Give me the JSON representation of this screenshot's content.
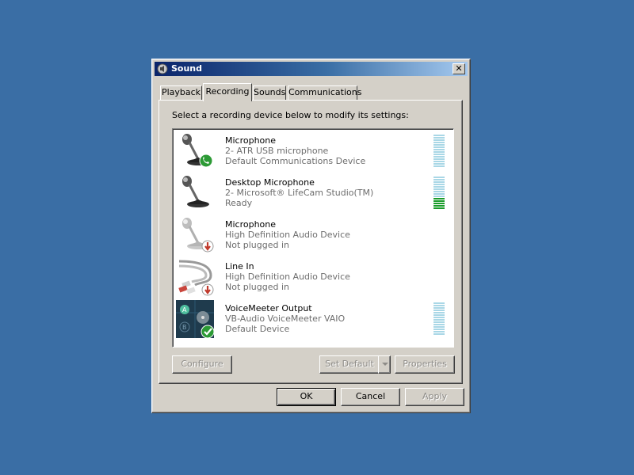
{
  "window": {
    "title": "Sound",
    "close_label": "✕"
  },
  "tabs": [
    {
      "label": "Playback",
      "active": false
    },
    {
      "label": "Recording",
      "active": true
    },
    {
      "label": "Sounds",
      "active": false
    },
    {
      "label": "Communications",
      "active": false
    }
  ],
  "instruction": "Select a recording device below to modify its settings:",
  "devices": [
    {
      "name": "Microphone",
      "description": "2- ATR USB microphone",
      "status": "Default Communications Device",
      "icon": "microphone-icon",
      "badge": "phone-badge-icon",
      "meter_level": 0
    },
    {
      "name": "Desktop Microphone",
      "description": "2- Microsoft® LifeCam Studio(TM)",
      "status": "Ready",
      "icon": "microphone-icon",
      "badge": "",
      "meter_level": 0.35
    },
    {
      "name": "Microphone",
      "description": "High Definition Audio Device",
      "status": "Not plugged in",
      "icon": "microphone-icon",
      "badge": "unplugged-badge-icon"
    },
    {
      "name": "Line In",
      "description": "High Definition Audio Device",
      "status": "Not plugged in",
      "icon": "line-in-cable-icon",
      "badge": "unplugged-badge-icon"
    },
    {
      "name": "VoiceMeeter Output",
      "description": "VB-Audio VoiceMeeter VAIO",
      "status": "Default Device",
      "icon": "voicemeeter-icon",
      "badge": "check-badge-icon",
      "meter_level": 0
    }
  ],
  "buttons": {
    "configure": "Configure",
    "set_default": "Set Default",
    "properties": "Properties",
    "ok": "OK",
    "cancel": "Cancel",
    "apply": "Apply"
  },
  "colors": {
    "desktop": "#3a6ea5",
    "meter_idle": "#a9d7e6",
    "meter_active": "#1a9c2a"
  }
}
